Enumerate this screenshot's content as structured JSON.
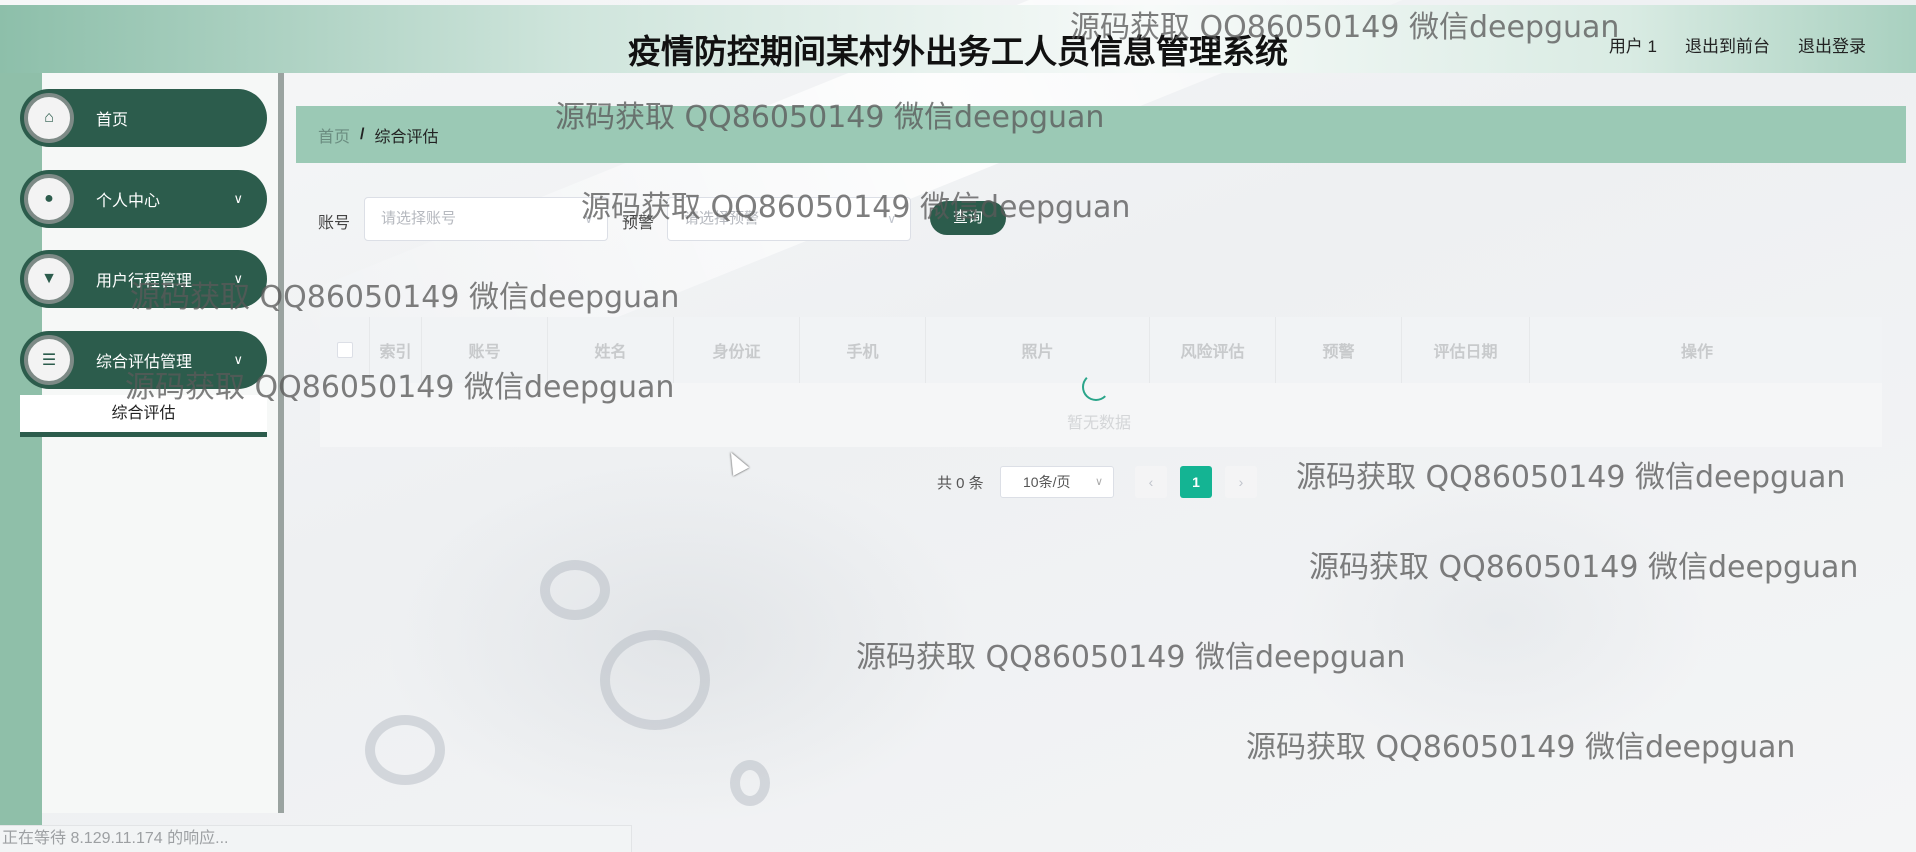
{
  "header": {
    "title": "疫情防控期间某村外出务工人员信息管理系统",
    "user": "用户 1",
    "back_link": "退出到前台",
    "logout_link": "退出登录"
  },
  "sidebar": {
    "items": [
      {
        "label": "首页",
        "icon": "home-icon",
        "has_children": false,
        "chevron": ""
      },
      {
        "label": "个人中心",
        "icon": "user-icon",
        "has_children": true,
        "chevron": "∨"
      },
      {
        "label": "用户行程管理",
        "icon": "itinerary-icon",
        "has_children": true,
        "chevron": "∨"
      },
      {
        "label": "综合评估管理",
        "icon": "list-icon",
        "has_children": true,
        "chevron": "∨"
      }
    ],
    "submenu": {
      "label": "综合评估"
    }
  },
  "breadcrumb": {
    "home": "首页",
    "separator": "/",
    "current": "综合评估"
  },
  "search": {
    "account_label": "账号",
    "account_placeholder": "请选择账号",
    "warning_label": "预警",
    "warning_placeholder": "请选择预警",
    "query_button": "查询"
  },
  "table": {
    "columns": [
      "索引",
      "账号",
      "姓名",
      "身份证",
      "手机",
      "照片",
      "风险评估",
      "预警",
      "评估日期",
      "操作"
    ],
    "rows": [],
    "empty_text": "暂无数据"
  },
  "pagination": {
    "total": "共 0 条",
    "page_size": "10条/页",
    "prev": "‹",
    "current_page": "1",
    "next": "›"
  },
  "watermarks": [
    "源码获取 QQ86050149 微信deepguan",
    "源码获取 QQ86050149 微信deepguan",
    "源码获取 QQ86050149 微信deepguan",
    "源码获取 QQ86050149 微信deepguan",
    "源码获取 QQ86050149 微信deepguan",
    "源码获取 QQ86050149 微信deepguan",
    "源码获取 QQ86050149 微信deepguan",
    "源码获取 QQ86050149 微信deepguan",
    "源码获取 QQ86050149 微信deepguan"
  ],
  "status_bar": "正在等待 8.129.11.174 的响应...",
  "colors": {
    "primary": "#2c5c4c",
    "accent": "#14b493",
    "breadcrumb_bg": "#9bc9b5",
    "side_strip": "#8fbfa9"
  }
}
